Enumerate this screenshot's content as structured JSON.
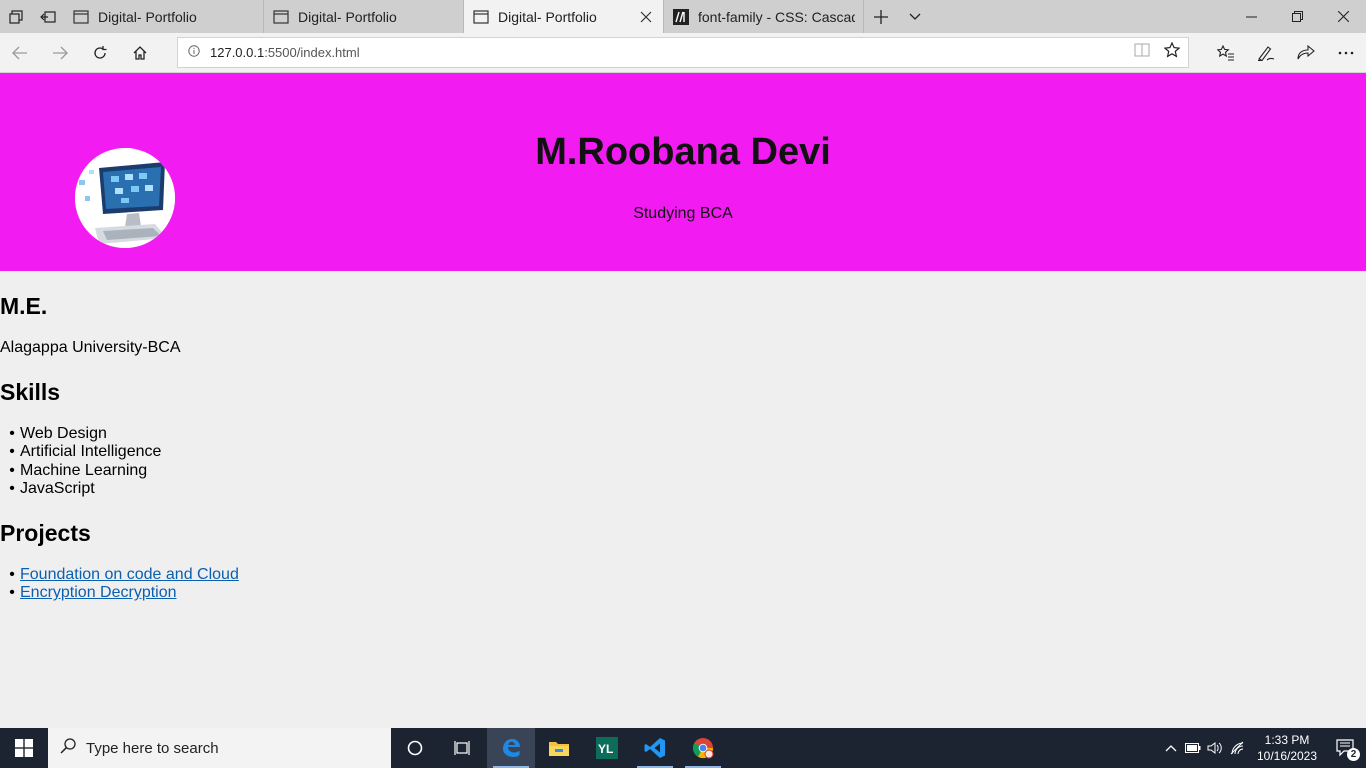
{
  "browser": {
    "tabs": [
      {
        "title": "Digital- Portfolio",
        "active": false
      },
      {
        "title": "Digital- Portfolio",
        "active": false
      },
      {
        "title": "Digital- Portfolio",
        "active": true
      },
      {
        "title": "font-family - CSS: Cascading",
        "active": false
      }
    ],
    "url_host": "127.0.0.1",
    "url_path": ":5500/index.html"
  },
  "hero": {
    "name": "M.Roobana Devi",
    "subtitle": "Studying BCA",
    "background": "#f21cf3"
  },
  "education": {
    "heading": "M.E.",
    "text": "Alagappa University-BCA"
  },
  "skills": {
    "heading": "Skills",
    "items": [
      "Web Design",
      "Artificial Intelligence",
      "Machine Learning",
      "JavaScript"
    ]
  },
  "projects": {
    "heading": "Projects",
    "items": [
      "Foundation on code and Cloud",
      "Encryption Decryption"
    ]
  },
  "taskbar": {
    "search_placeholder": "Type here to search",
    "time": "1:33 PM",
    "date": "10/16/2023",
    "notification_count": "2"
  },
  "icons": {
    "back": "back-arrow-icon",
    "forward": "forward-arrow-icon",
    "refresh": "refresh-icon",
    "home": "home-icon",
    "favorites": "favorites-icon",
    "pen": "pen-icon",
    "share": "share-icon",
    "more": "more-icon"
  }
}
